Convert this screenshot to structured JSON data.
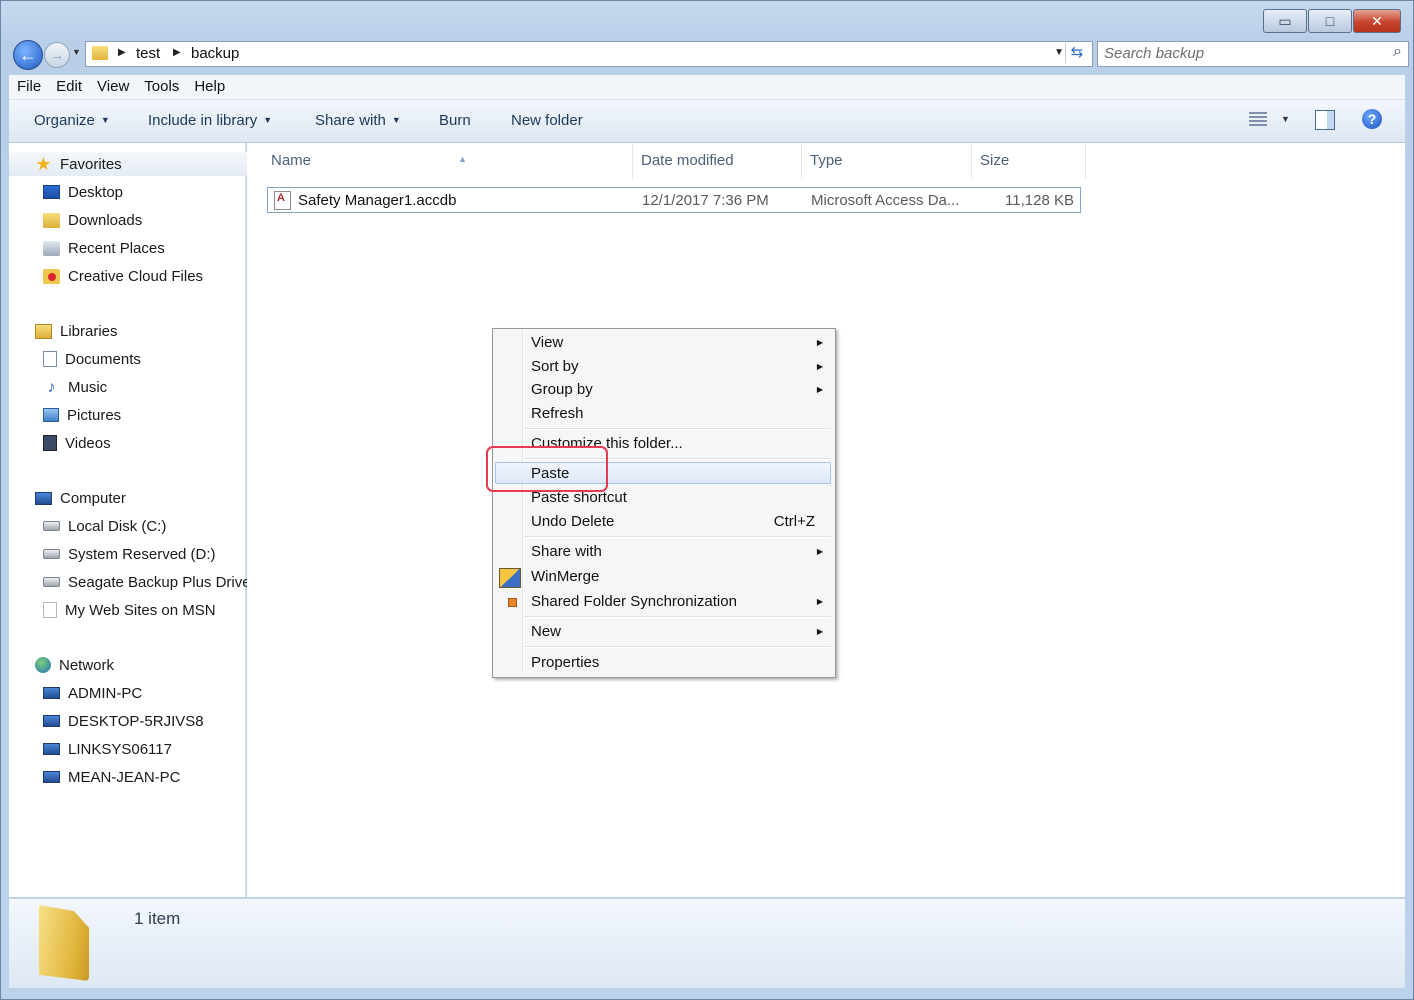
{
  "window": {
    "caption_buttons": {
      "minimize": "▭",
      "maximize": "□",
      "close": "✕"
    }
  },
  "address": {
    "crumbs": [
      "test",
      "backup"
    ],
    "search_placeholder": "Search backup"
  },
  "menu": [
    "File",
    "Edit",
    "View",
    "Tools",
    "Help"
  ],
  "toolbar": {
    "organize": "Organize",
    "include": "Include in library",
    "share": "Share with",
    "burn": "Burn",
    "new_folder": "New folder"
  },
  "nav": {
    "favorites": {
      "label": "Favorites",
      "items": [
        "Desktop",
        "Downloads",
        "Recent Places",
        "Creative Cloud Files"
      ]
    },
    "libraries": {
      "label": "Libraries",
      "items": [
        "Documents",
        "Music",
        "Pictures",
        "Videos"
      ]
    },
    "computer": {
      "label": "Computer",
      "items": [
        "Local Disk (C:)",
        "System Reserved (D:)",
        "Seagate Backup Plus Drive",
        "My Web Sites on MSN"
      ]
    },
    "network": {
      "label": "Network",
      "items": [
        "ADMIN-PC",
        "DESKTOP-5RJIVS8",
        "LINKSYS06117",
        "MEAN-JEAN-PC"
      ]
    }
  },
  "columns": {
    "name": "Name",
    "date": "Date modified",
    "type": "Type",
    "size": "Size"
  },
  "files": [
    {
      "name": "Safety Manager1.accdb",
      "date": "12/1/2017 7:36 PM",
      "type": "Microsoft Access Da...",
      "size": "11,128 KB"
    }
  ],
  "context_menu": {
    "view": "View",
    "sort_by": "Sort by",
    "group_by": "Group by",
    "refresh": "Refresh",
    "customize": "Customize this folder...",
    "paste": "Paste",
    "paste_shortcut": "Paste shortcut",
    "undo_delete": "Undo Delete",
    "undo_shortcut": "Ctrl+Z",
    "share_with": "Share with",
    "winmerge": "WinMerge",
    "shared_sync": "Shared Folder Synchronization",
    "new": "New",
    "properties": "Properties"
  },
  "status": {
    "count": "1 item"
  },
  "accent": {
    "highlight": "#e53a4f",
    "selection_border": "#7da2ce"
  }
}
